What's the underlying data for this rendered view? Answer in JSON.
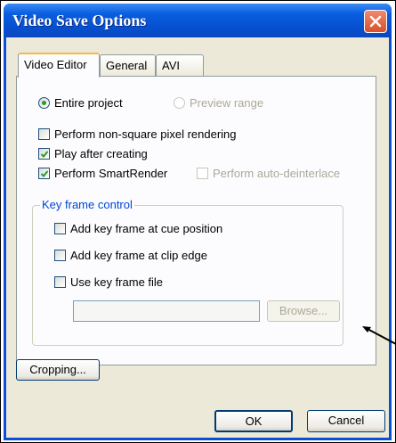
{
  "window": {
    "title": "Video Save Options"
  },
  "tabs": [
    {
      "label": "Video Editor",
      "active": true
    },
    {
      "label": "General",
      "active": false
    },
    {
      "label": "AVI",
      "active": false
    }
  ],
  "range": {
    "entire_project": {
      "label": "Entire project",
      "selected": true
    },
    "preview_range": {
      "label": "Preview range",
      "selected": false,
      "enabled": false
    }
  },
  "options": {
    "non_square": {
      "label": "Perform non-square pixel rendering",
      "checked": false
    },
    "play_after": {
      "label": "Play after creating",
      "checked": true
    },
    "smartrender": {
      "label": "Perform SmartRender",
      "checked": true
    },
    "auto_deinterlace": {
      "label": "Perform auto-deinterlace",
      "checked": false,
      "enabled": false
    }
  },
  "keyframe": {
    "title": "Key frame control",
    "cue": {
      "label": "Add key frame at cue position",
      "checked": false
    },
    "clip_edge": {
      "label": "Add key frame at clip edge",
      "checked": false
    },
    "use_file": {
      "label": "Use key frame file",
      "checked": false
    },
    "file_value": "",
    "browse_label": "Browse..."
  },
  "buttons": {
    "cropping": "Cropping...",
    "ok": "OK",
    "cancel": "Cancel"
  },
  "colors": {
    "titlebar": "#0a5ee0",
    "dialog_bg": "#ece9d8",
    "group_title": "#0046d5",
    "check": "#2d9a2d"
  }
}
